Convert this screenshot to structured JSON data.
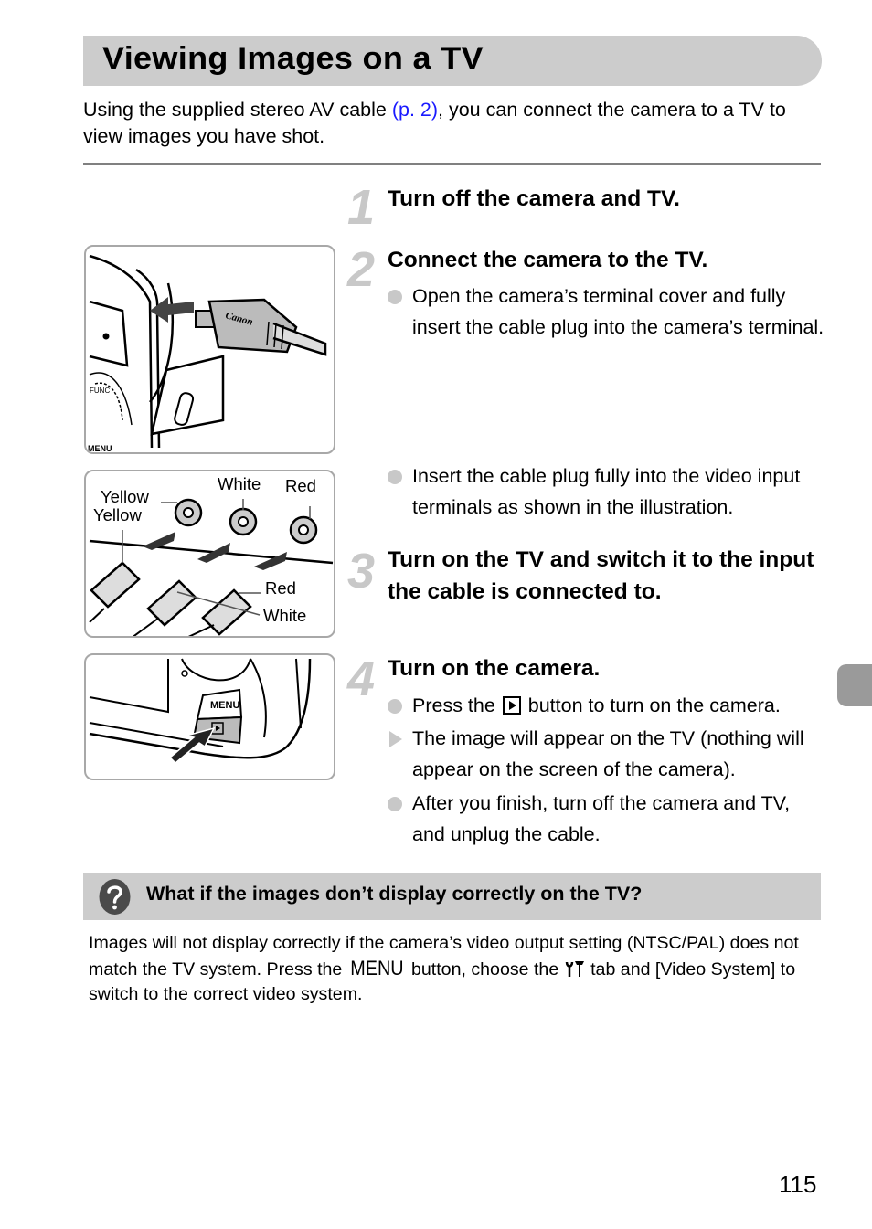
{
  "page": {
    "title": "Viewing Images on a TV",
    "intro_before_link": "Using the supplied stereo AV cable ",
    "intro_link": "(p. 2)",
    "intro_after_link": ", you can connect the camera to a TV to view images you have shot.",
    "page_number": "115",
    "link_color": "#1a1aff"
  },
  "steps": [
    {
      "number": "1",
      "title": "Turn off the camera and TV.",
      "bullets": []
    },
    {
      "number": "2",
      "title": "Connect the camera to the TV.",
      "bullets": [
        {
          "type": "circle",
          "text": "Open the camera’s terminal cover and fully insert the cable plug into the camera’s terminal."
        },
        {
          "type": "circle",
          "text": "Insert the cable plug fully into the video input terminals as shown in the illustration."
        }
      ]
    },
    {
      "number": "3",
      "title": "Turn on the TV and switch it to the input the cable is connected to.",
      "bullets": []
    },
    {
      "number": "4",
      "title": "Turn on the camera.",
      "bullets": [
        {
          "type": "circle",
          "text_before_icon": "Press the ",
          "icon": "play-button-icon",
          "text_after_icon": " button to turn on the camera."
        },
        {
          "type": "triangle",
          "text": "The image will appear on the TV (nothing will appear on the screen of the camera)."
        },
        {
          "type": "circle",
          "text": "After you finish, turn off the camera and TV, and unplug the cable."
        }
      ]
    }
  ],
  "illustrations": {
    "camera_cable": {
      "plug_brand": "Canon",
      "button_label": "MENU",
      "dial_label": "FUNC SET"
    },
    "tv_terminals": {
      "jack_labels": [
        "Yellow",
        "White",
        "Red"
      ],
      "plug_labels": [
        "Yellow",
        "White",
        "Red"
      ]
    },
    "camera_play": {
      "button_label": "MENU"
    }
  },
  "note": {
    "icon": "question-icon",
    "title": "What if the images don’t display correctly on the TV?",
    "body_part1": "Images will not display correctly if the camera’s video output setting (NTSC/PAL) does not match the TV system. Press the ",
    "menu_label": "MENU",
    "body_part2": " button, choose the ",
    "tab_icon": "tools-icon",
    "body_part3": " tab and [Video System] to switch to the correct video system."
  }
}
